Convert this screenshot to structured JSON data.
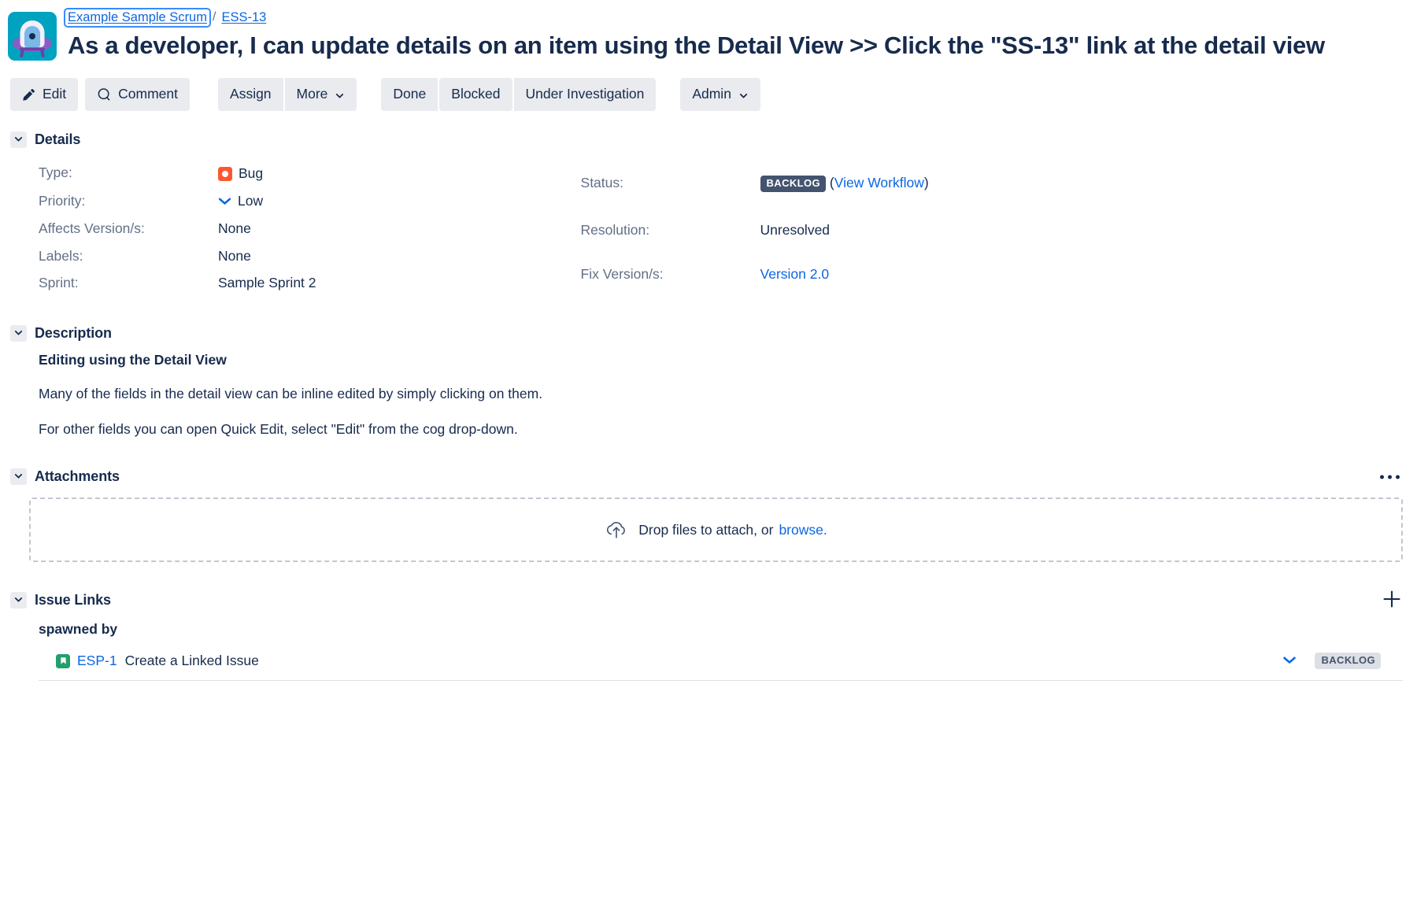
{
  "header": {
    "avatar_name": "project-avatar-ufo",
    "breadcrumb": {
      "project": "Example Sample Scrum",
      "separator": "/",
      "issue_key": "ESS-13"
    },
    "issue_title": "As a developer, I can update details on an item using the Detail View >> Click the \"SS-13\" link at the detail view"
  },
  "toolbar": {
    "edit": "Edit",
    "comment": "Comment",
    "assign": "Assign",
    "more": "More",
    "done": "Done",
    "blocked": "Blocked",
    "under_investigation": "Under Investigation",
    "admin": "Admin"
  },
  "details": {
    "section_title": "Details",
    "left": [
      {
        "label": "Type:",
        "value": "Bug",
        "icon": "bug-type-icon"
      },
      {
        "label": "Priority:",
        "value": "Low",
        "icon": "priority-low-icon"
      },
      {
        "label": "Affects Version/s:",
        "value": "None",
        "icon": null
      },
      {
        "label": "Labels:",
        "value": "None",
        "icon": null
      },
      {
        "label": "Sprint:",
        "value": "Sample Sprint 2",
        "icon": null
      }
    ],
    "right": [
      {
        "label": "Status:",
        "value": "BACKLOG",
        "link": "View Workflow",
        "paren_open": "(",
        "paren_close": ")"
      },
      {
        "label": "Resolution:",
        "value": "Unresolved"
      },
      {
        "label": "Fix Version/s:",
        "value": "Version 2.0"
      }
    ]
  },
  "description": {
    "section_title": "Description",
    "heading": "Editing using the Detail View",
    "paragraphs": [
      "Many of the fields in the detail view can be inline edited by simply clicking on them.",
      "For other fields you can open Quick Edit, select \"Edit\" from the cog drop-down."
    ]
  },
  "attachments": {
    "section_title": "Attachments",
    "dropzone_text": "Drop files to attach, or",
    "browse_link": "browse.",
    "more_icon": "more-options-icon"
  },
  "issue_links": {
    "section_title": "Issue Links",
    "add_icon": "add-link-icon",
    "groups": [
      {
        "relation": "spawned by",
        "items": [
          {
            "key": "ESP-1",
            "summary": "Create a Linked Issue",
            "type_icon": "story-icon",
            "priority_icon": "priority-low-icon",
            "status": "BACKLOG"
          }
        ]
      }
    ]
  },
  "colors": {
    "link": "#0c66e4",
    "text": "#172b4d",
    "muted": "#626f86",
    "bug": "#ff5630",
    "story": "#22a06b",
    "lozenge_bold": "#44546f",
    "lozenge_subtle": "#dcdfe4",
    "button_bg": "#e9ebee",
    "avatar_bg": "#00a3bf"
  }
}
